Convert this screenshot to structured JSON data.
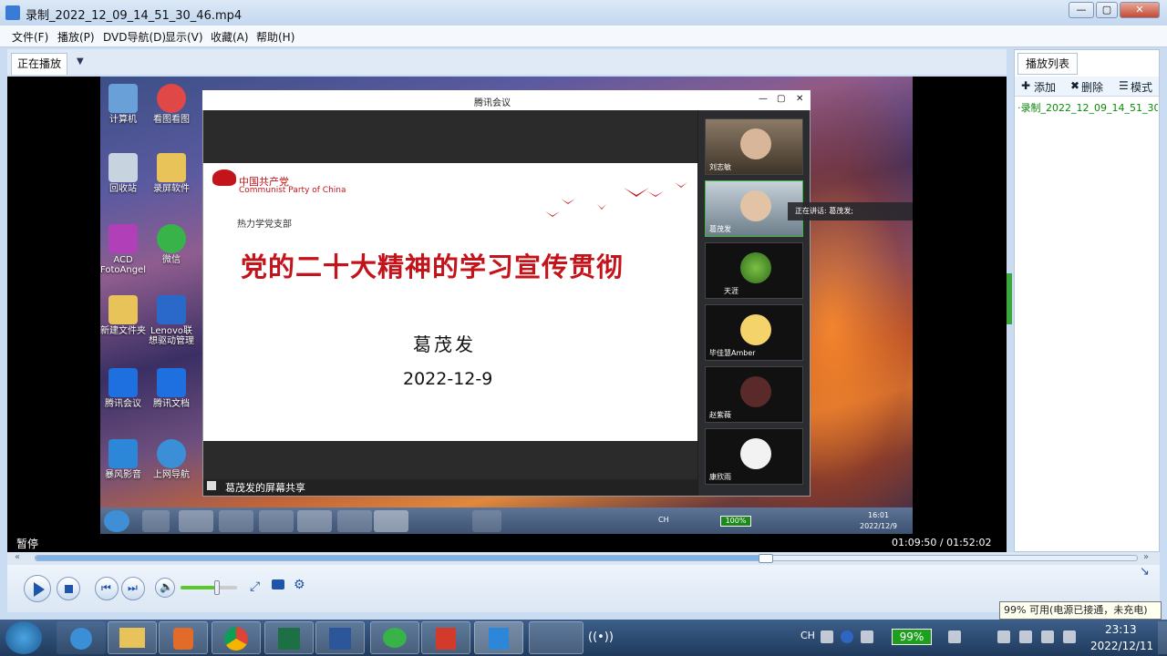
{
  "window": {
    "title": "录制_2022_12_09_14_51_30_46.mp4",
    "min": "—",
    "max": "▢",
    "close": "✕"
  },
  "menu": [
    "文件(F)",
    "播放(P)",
    "DVD导航(D)",
    "显示(V)",
    "收藏(A)",
    "帮助(H)"
  ],
  "tabs": {
    "now_playing": "正在播放",
    "playlist": "播放列表",
    "dropdown": "▼"
  },
  "desktop_icons": [
    "计算机",
    "看图看图",
    "回收站",
    "录屏软件",
    "ACD FotoAngel",
    "微信",
    "新建文件夹",
    "Lenovo联想驱动管理",
    "腾讯会议",
    "腾讯文档",
    "暴风影音",
    "上网导航"
  ],
  "meeting": {
    "title": "腾讯会议",
    "controls": [
      "—",
      "▢",
      "✕"
    ],
    "slide": {
      "party_cn": "中国共产党",
      "party_en": "Communist Party of China",
      "branch": "热力学党支部",
      "title": "党的二十大精神的学习宣传贯彻",
      "presenter": "葛茂发",
      "date": "2022-12-9"
    },
    "share_label": "葛茂发的屏幕共享",
    "speaking": "正在讲话: 葛茂发;",
    "participants": [
      "刘志敏",
      "葛茂发",
      "天涯",
      "毕佳慧Amber",
      "赵紫薇",
      "康欣雨"
    ]
  },
  "inner_taskbar": {
    "lang": "CH",
    "battery": "100%",
    "time": "16:01",
    "date": "2022/12/9"
  },
  "status": {
    "state": "暂停",
    "time": "01:09:50 / 01:52:02"
  },
  "playback": {
    "progress": 0.6633,
    "volume": 0.65
  },
  "playlist": {
    "add": "添加",
    "delete": "删除",
    "mode": "模式",
    "entry": "·录制_2022_12_09_14_51_30_46.mp4"
  },
  "tooltip": "99% 可用(电源已接通，未充电)",
  "taskbar": {
    "lang": "CH",
    "battery": "99%",
    "time": "23:13",
    "date": "2022/12/11"
  },
  "colors": {
    "accent": "#c4141b",
    "green": "#1da01d"
  }
}
